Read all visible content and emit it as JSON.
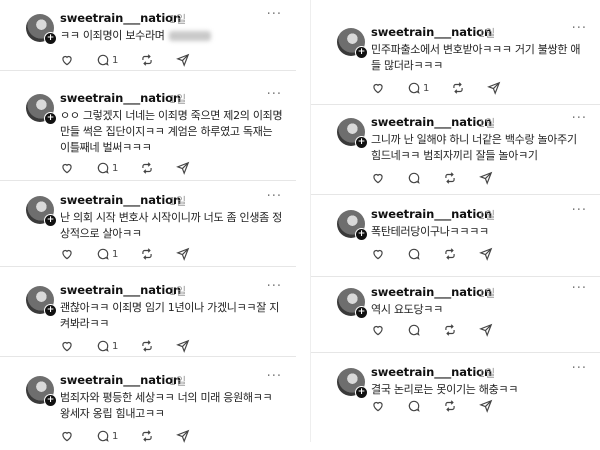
{
  "left_column": {
    "posts": [
      {
        "username": "sweetrain___nation",
        "time": "1일",
        "text": "ㅋㅋ 이죄명이 보수라며",
        "has_blur": true,
        "reply_count": "1"
      },
      {
        "username": "sweetrain___nation",
        "time": "1일",
        "text": "ㅇㅇ 그렇겠지 너네는 이죄명 죽으면 제2의 이죄명 만들 썩은 집단이지ㅋㅋ 계엄은 하루였고 독재는 이틀째네 벌써ㅋㅋㅋ",
        "has_blur": false,
        "reply_count": "1"
      },
      {
        "username": "sweetrain___nation",
        "time": "1일",
        "text": "난 의회 시작 변호사 시작이니까 너도 좀 인생좀 정상적으로 살아ㅋㅋ",
        "has_blur": false,
        "reply_count": "1"
      },
      {
        "username": "sweetrain___nation",
        "time": "1일",
        "text": "괜찮아ㅋㅋ 이죄명 임기 1년이나 가겠니ㅋㅋ잘 지켜봐라ㅋㅋ",
        "has_blur": false,
        "reply_count": "1"
      },
      {
        "username": "sweetrain___nation",
        "time": "1일",
        "text": "범죄자와 평등한 세상ㅋㅋ 너의 미래 응원해ㅋㅋ 왕세자 옹립 힘내고ㅋㅋ",
        "has_blur": false,
        "reply_count": "1"
      }
    ]
  },
  "right_column": {
    "posts": [
      {
        "username": "sweetrain___nation",
        "time": "1일",
        "text": "민주파출소에서 변호받아ㅋㅋㅋ 거기 불쌍한 애들 많더라ㅋㅋㅋ",
        "reply_count": "1"
      },
      {
        "username": "sweetrain___nation",
        "time": "1일",
        "text": "그니까 난 일해야 하니 너같은 백수랑 놀아주기 힘드네ㅋㅋ 범죄자끼리 잘들 놀아ㅋ기",
        "reply_count": ""
      },
      {
        "username": "sweetrain___nation",
        "time": "1일",
        "text": "폭탄테러당이구나ㅋㅋㅋㅋ",
        "reply_count": ""
      },
      {
        "username": "sweetrain___nation",
        "time": "1일",
        "text": "역시 요도당ㅋㅋ",
        "reply_count": ""
      },
      {
        "username": "sweetrain___nation",
        "time": "1일",
        "text": "결국 논리로는 못이기는 해충ㅋㅋ",
        "reply_count": ""
      }
    ]
  },
  "labels": {
    "more": "···",
    "plus": "+"
  },
  "icons": [
    "heart-icon",
    "reply-icon",
    "repost-icon",
    "share-icon"
  ],
  "colors": {
    "text": "#111111",
    "muted": "#9a9a9a",
    "divider": "#e6e6e6"
  }
}
